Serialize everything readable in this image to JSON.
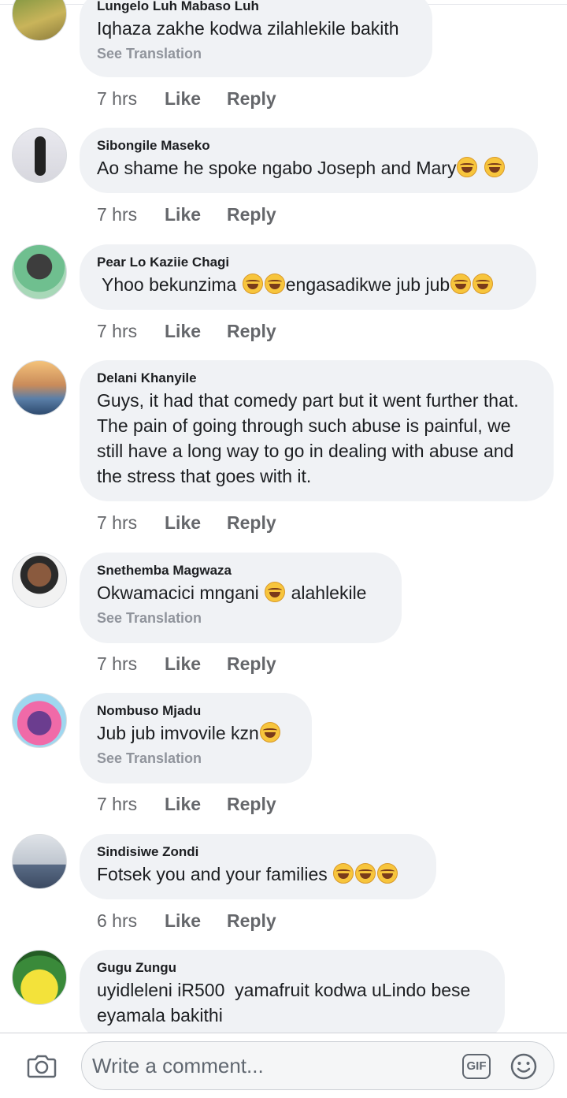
{
  "comments": [
    {
      "author": "Lungelo Luh Mabaso Luh",
      "text": "Iqhaza zakhe kodwa zilahlekile bakith",
      "translation": "See Translation",
      "time": "7 hrs",
      "like": "Like",
      "reply": "Reply",
      "avatar": "avatar-photo"
    },
    {
      "author": "Sibongile Maseko",
      "text": "Ao shame he spoke ngabo Joseph and Mary",
      "time": "7 hrs",
      "like": "Like",
      "reply": "Reply",
      "avatar": "avatar-photo"
    },
    {
      "author": "Pear Lo Kaziie Chagi",
      "text": "Yhoo bekunzima",
      "text2": "engasadikwe jub jub",
      "time": "7 hrs",
      "like": "Like",
      "reply": "Reply",
      "avatar": "avatar-photo"
    },
    {
      "author": "Delani Khanyile",
      "text": "Guys, it had that comedy part but it went further that. The pain of going through such abuse is painful, we still have a long way to go in dealing with abuse and the stress that goes with it.",
      "time": "7 hrs",
      "like": "Like",
      "reply": "Reply",
      "avatar": "avatar-photo"
    },
    {
      "author": "Snethemba Magwaza",
      "text": "Okwamacici mngani",
      "text2": "alahlekile",
      "translation": "See Translation",
      "time": "7 hrs",
      "like": "Like",
      "reply": "Reply",
      "avatar": "avatar-photo"
    },
    {
      "author": "Nombuso Mjadu",
      "text": "Jub jub imvovile kzn",
      "translation": "See Translation",
      "time": "7 hrs",
      "like": "Like",
      "reply": "Reply",
      "avatar": "avatar-photo"
    },
    {
      "author": "Sindisiwe Zondi",
      "text": "Fotsek you and your families",
      "time": "6 hrs",
      "like": "Like",
      "reply": "Reply",
      "avatar": "avatar-photo"
    },
    {
      "author": "Gugu Zungu",
      "text": "uyidleleni iR500  yamafruit kodwa uLindo bese eyamala bakithi",
      "avatar": "avatar-photo"
    }
  ],
  "composer": {
    "placeholder": "Write a comment...",
    "gif_label": "GIF",
    "camera_icon": "camera-icon",
    "emoji_icon": "smiley-icon"
  },
  "colors": {
    "bubble": "#f0f2f5",
    "meta_text": "#65676b",
    "translation_text": "#90949c"
  }
}
